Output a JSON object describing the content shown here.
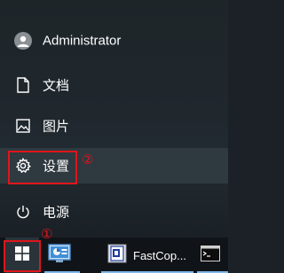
{
  "start_menu": {
    "user_name": "Administrator",
    "items": [
      {
        "label": "文档",
        "icon": "document-icon"
      },
      {
        "label": "图片",
        "icon": "picture-icon"
      },
      {
        "label": "设置",
        "icon": "gear-icon"
      },
      {
        "label": "电源",
        "icon": "power-icon"
      }
    ]
  },
  "annotations": {
    "step1": "①",
    "step2": "②",
    "color": "#e0151b"
  },
  "taskbar": {
    "start_icon": "windows-logo-icon",
    "apps": [
      {
        "icon": "control-panel-icon",
        "label": ""
      },
      {
        "icon": "fastcopy-icon",
        "label": "FastCop..."
      },
      {
        "icon": "command-prompt-icon",
        "label": ""
      }
    ]
  }
}
